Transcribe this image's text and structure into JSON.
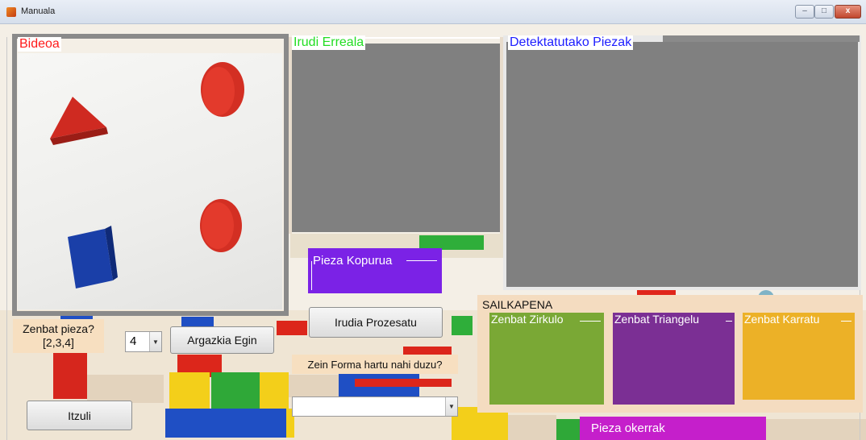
{
  "window": {
    "title": "Manuala",
    "minimize_label": "",
    "maximize_label": "",
    "close_label": "x"
  },
  "panels": {
    "bideoa": {
      "title": "Bideoa",
      "title_color": "#ff1a1a"
    },
    "irudi_erreala": {
      "title": "Irudi Erreala",
      "title_color": "#22dd22"
    },
    "detektatutako": {
      "title": "Detektatutako Piezak",
      "title_color": "#1d1dff"
    },
    "pieza_kopurua": {
      "title": "Pieza Kopurua",
      "title_color": "#ffffff"
    },
    "sailkapena": {
      "title": "SAILKAPENA",
      "subpanels": [
        {
          "title": "Zenbat Zirkulo",
          "color": "#7aa835"
        },
        {
          "title": "Zenbat Triangelu",
          "color": "#7b2f94"
        },
        {
          "title": "Zenbat Karratu",
          "color": "#ecb127"
        }
      ]
    }
  },
  "controls": {
    "zenbat_pieza_label": "Zenbat pieza?\n[2,3,4]",
    "zenbat_pieza_line1": "Zenbat pieza?",
    "zenbat_pieza_line2": "[2,3,4]",
    "pieza_select_value": "4",
    "argazkia_button": "Argazkia Egin",
    "irudia_button": "Irudia Prozesatu",
    "forma_question": "Zein Forma hartu nahi duzu?",
    "forma_select_value": "",
    "itzuli_button": "Itzuli",
    "pieza_okerrak": "Pieza okerrak"
  },
  "icons": {
    "app": "matlab-icon",
    "dropdown": "chevron-down-icon"
  }
}
